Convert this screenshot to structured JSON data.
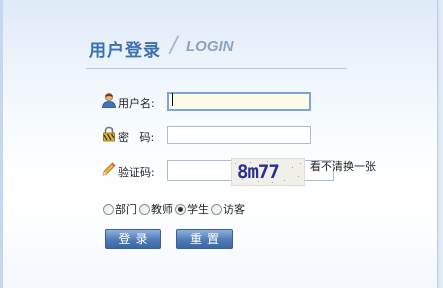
{
  "header": {
    "title_cn": "用户登录",
    "separator": "/",
    "title_en": "LOGIN"
  },
  "form": {
    "username_label": "用户名:",
    "username_value": "",
    "password_label": "密   码:",
    "password_value": "",
    "captcha_label": "验证码:",
    "captcha_value": "",
    "captcha_text": "8m77",
    "captcha_refresh": "看不清换一张"
  },
  "roles": [
    {
      "label": "部门",
      "checked": false
    },
    {
      "label": "教师",
      "checked": false
    },
    {
      "label": "学生",
      "checked": true
    },
    {
      "label": "访客",
      "checked": false
    }
  ],
  "buttons": {
    "login": "登录",
    "reset": "重置"
  },
  "icons": {
    "username": "user-icon",
    "password": "lock-icon",
    "captcha": "pencil-icon"
  },
  "colors": {
    "title": "#3c6fb0",
    "button": "#4f7bb7",
    "accent_border": "#7ea3d6"
  }
}
